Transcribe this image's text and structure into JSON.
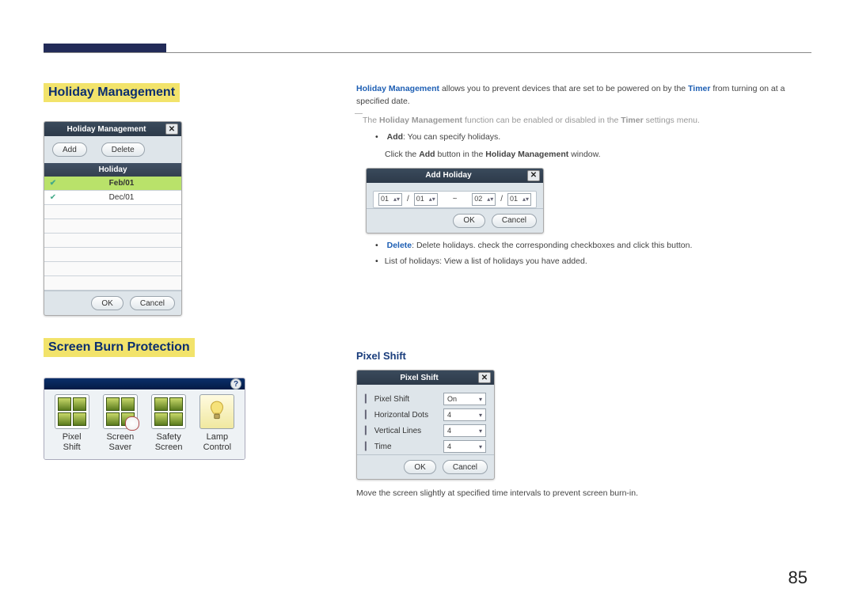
{
  "page": {
    "number": "85"
  },
  "sections": {
    "holiday_mgmt": {
      "title": "Holiday Management",
      "intro_pre": "Holiday Management",
      "intro_mid": " allows you to prevent devices that are set to be powered on by the ",
      "intro_timer": "Timer",
      "intro_post": " from turning on at a specified date.",
      "note_pre": "The ",
      "note_bold1": "Holiday Management",
      "note_mid": " function can be enabled or disabled in the ",
      "note_bold2": "Timer",
      "note_post": " settings menu.",
      "add_label": "Add",
      "add_desc": ": You can specify holidays.",
      "add_click_pre": "Click the ",
      "add_click_b1": "Add",
      "add_click_mid": " button in the ",
      "add_click_b2": "Holiday Management",
      "add_click_post": " window.",
      "delete_label": "Delete",
      "delete_desc": ": Delete holidays. check the corresponding checkboxes and click this button.",
      "list_desc": "List of holidays: View a list of holidays you have added."
    },
    "sbp": {
      "title": "Screen Burn Protection"
    },
    "pixel_shift": {
      "title": "Pixel Shift",
      "desc": "Move the screen slightly at specified time intervals to prevent screen burn-in."
    }
  },
  "hm_dialog": {
    "title": "Holiday Management",
    "btn_add": "Add",
    "btn_delete": "Delete",
    "col_header": "Holiday",
    "rows": [
      {
        "checked": true,
        "date": "Feb/01",
        "selected": true
      },
      {
        "checked": true,
        "date": "Dec/01",
        "selected": false
      }
    ],
    "btn_ok": "OK",
    "btn_cancel": "Cancel"
  },
  "ah_dialog": {
    "title": "Add Holiday",
    "from_m": "01",
    "from_d": "01",
    "sep": "~",
    "to_m": "02",
    "to_d": "01",
    "btn_ok": "OK",
    "btn_cancel": "Cancel"
  },
  "sb_panel": {
    "help": "?",
    "items": [
      {
        "name": "pixel-shift",
        "label1": "Pixel",
        "label2": "Shift"
      },
      {
        "name": "screen-saver",
        "label1": "Screen",
        "label2": "Saver"
      },
      {
        "name": "safety-screen",
        "label1": "Safety",
        "label2": "Screen"
      },
      {
        "name": "lamp-control",
        "label1": "Lamp",
        "label2": "Control"
      }
    ]
  },
  "ps_dialog": {
    "title": "Pixel Shift",
    "rows": [
      {
        "label": "Pixel Shift",
        "value": "On"
      },
      {
        "label": "Horizontal Dots",
        "value": "4"
      },
      {
        "label": "Vertical Lines",
        "value": "4"
      },
      {
        "label": "Time",
        "value": "4"
      }
    ],
    "btn_ok": "OK",
    "btn_cancel": "Cancel"
  }
}
